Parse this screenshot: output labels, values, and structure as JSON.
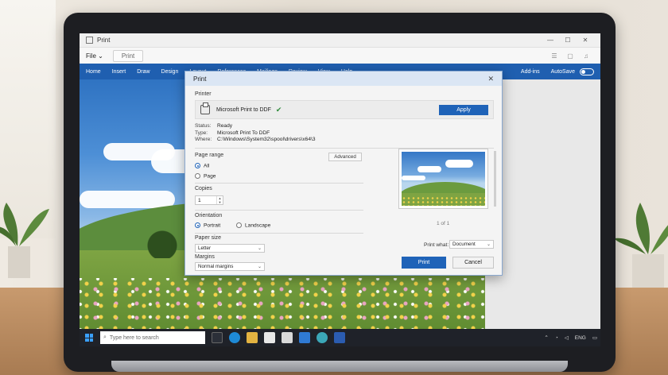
{
  "app": {
    "title": "Print"
  },
  "menubar": {
    "file": "File",
    "print_chip": "Print"
  },
  "ribbon": {
    "tabs": [
      "Home",
      "Insert",
      "Draw",
      "Design",
      "Layout",
      "References",
      "Mailings",
      "Review",
      "View",
      "Help"
    ],
    "addins": "Add-ins",
    "autosave": "AutoSave"
  },
  "dialog": {
    "title": "Print",
    "printer_section": "Printer",
    "printer_name": "Microsoft Print to DDF",
    "apply_label": "Apply",
    "status_key": "Status:",
    "status_val": "Ready",
    "type_key": "Type:",
    "type_val": "Microsoft Print To DDF",
    "where_key": "Where:",
    "where_val": "C:\\Windows\\System32\\spool\\drivers\\x64\\3",
    "page_range_label": "Page range",
    "advanced_label": "Advanced",
    "range_all": "All",
    "range_page": "Page",
    "copies_label": "Copies",
    "copies_value": "1",
    "orientation_label": "Orientation",
    "portrait": "Portrait",
    "landscape": "Landscape",
    "paper_size_label": "Paper size",
    "paper_size_value": "Letter",
    "margins_label": "Margins",
    "margins_value": "Normal margins",
    "page_indicator": "1 of 1",
    "print_what_label": "Print what:",
    "print_what_value": "Document",
    "print_button": "Print",
    "cancel_button": "Cancel"
  },
  "taskbar": {
    "search_placeholder": "Type here to search",
    "lang": "ENG"
  },
  "colors": {
    "accent": "#1f63b8",
    "ribbon": "#1f5fb0",
    "taskbar": "#1f2229"
  }
}
